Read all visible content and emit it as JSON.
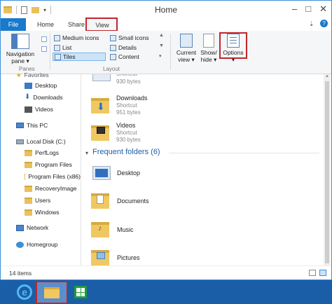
{
  "window": {
    "title": "Home",
    "help_glyph": "?"
  },
  "tabs": {
    "file": "File",
    "home": "Home",
    "share": "Share",
    "view": "View"
  },
  "ribbon": {
    "navigation_pane": [
      "Navigation",
      "pane"
    ],
    "panes_label": "Panes",
    "layout_label": "Layout",
    "layout_items": [
      "Medium icons",
      "List",
      "Tiles",
      "Small icons",
      "Details",
      "Content"
    ],
    "current_view": [
      "Current",
      "view"
    ],
    "show_hide": [
      "Show/",
      "hide"
    ],
    "options": "Options"
  },
  "nav": {
    "favorites": "Favorites",
    "desktop": "Desktop",
    "downloads": "Downloads",
    "videos": "Videos",
    "this_pc": "This PC",
    "local_disk": "Local Disk (C:)",
    "perflogs": "PerfLogs",
    "program_files": "Program Files",
    "program_files_x86": "Program Files (x86)",
    "recovery_image": "RecoveryImage",
    "users": "Users",
    "windows": "Windows",
    "network": "Network",
    "homegroup": "Homegroup"
  },
  "content": {
    "partial_item": {
      "type": "Shortcut",
      "size": "930 bytes"
    },
    "items": [
      {
        "name": "Downloads",
        "type": "Shortcut",
        "size": "951 bytes"
      },
      {
        "name": "Videos",
        "type": "Shortcut",
        "size": "930 bytes"
      }
    ],
    "frequent_header": "Frequent folders (6)",
    "frequent": [
      "Desktop",
      "Documents",
      "Music",
      "Pictures"
    ]
  },
  "status": {
    "items": "14 items"
  },
  "colors": {
    "accent": "#1979ca",
    "highlight": "#c0262d",
    "taskbar": "#1a5ea8"
  }
}
